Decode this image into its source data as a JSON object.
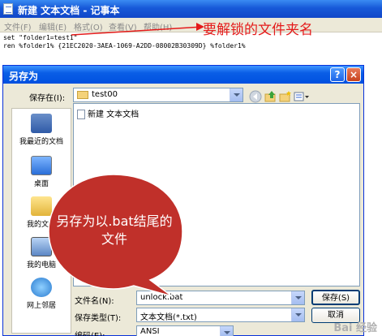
{
  "notepad": {
    "title": "新建 文本文档 - 记事本",
    "menu": [
      "文件(F)",
      "编辑(E)",
      "格式(O)",
      "查看(V)",
      "帮助(H)"
    ],
    "lines": [
      "set \"folder1=test1\"",
      "ren %folder1% {21EC2020-3AEA-1069-A2DD-08002B30309D} %folder1%"
    ]
  },
  "annotation": {
    "text": "要解锁的文件夹名",
    "color": "#e41a1a"
  },
  "dialog": {
    "title": "另存为",
    "help_label": "?",
    "close_label": "×",
    "save_in_label": "保存在(I):",
    "save_in_value": "test00",
    "places": [
      {
        "label": "我最近的文档",
        "icon": "recent-documents-icon"
      },
      {
        "label": "桌面",
        "icon": "desktop-icon"
      },
      {
        "label": "我的文档",
        "icon": "my-documents-icon"
      },
      {
        "label": "我的电脑",
        "icon": "my-computer-icon"
      },
      {
        "label": "网上邻居",
        "icon": "network-places-icon"
      }
    ],
    "files": [
      "新建 文本文档"
    ],
    "filename_label": "文件名(N):",
    "filename_value": "unlock.bat",
    "filetype_label": "保存类型(T):",
    "filetype_value": "文本文档(*.txt)",
    "encoding_label": "编码(E):",
    "encoding_value": "ANSI",
    "save_button": "保存(S)",
    "cancel_button": "取消"
  },
  "callout": {
    "text": "另存为以.bat结尾的文件",
    "color": "#c0302a"
  },
  "watermark": "Bai 经验"
}
